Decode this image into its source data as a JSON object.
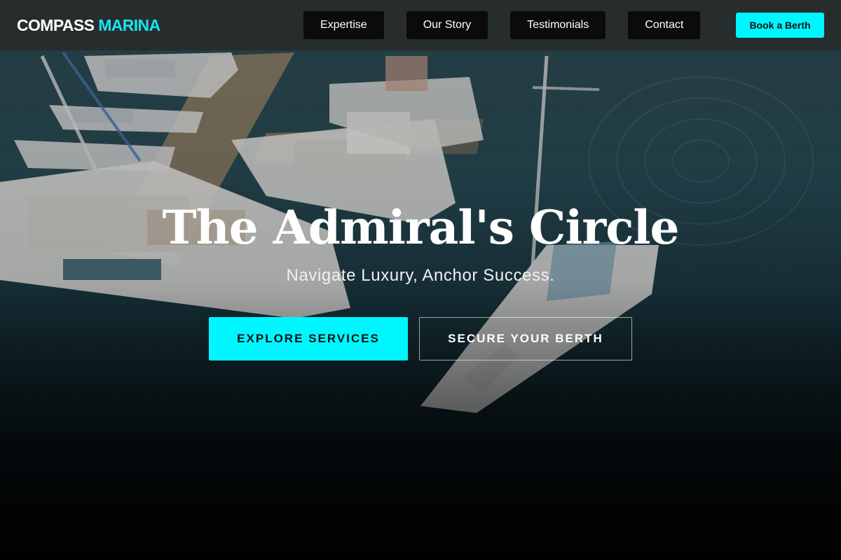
{
  "brand": {
    "name": "COMPASS",
    "accent": "MARINA"
  },
  "nav": {
    "links": [
      "Expertise",
      "Our Story",
      "Testimonials",
      "Contact"
    ],
    "cta": "Book a Berth"
  },
  "hero": {
    "title": "The Admiral's Circle",
    "subtitle": "Navigate Luxury, Anchor Success.",
    "primary_cta": "EXPLORE SERVICES",
    "secondary_cta": "SECURE YOUR BERTH",
    "background_image": "marina-yachts-aerial-photo"
  },
  "colors": {
    "accent": "#00f6ff",
    "brand_accent": "#18e4f0",
    "nav_bg": "#0b0b0b"
  }
}
